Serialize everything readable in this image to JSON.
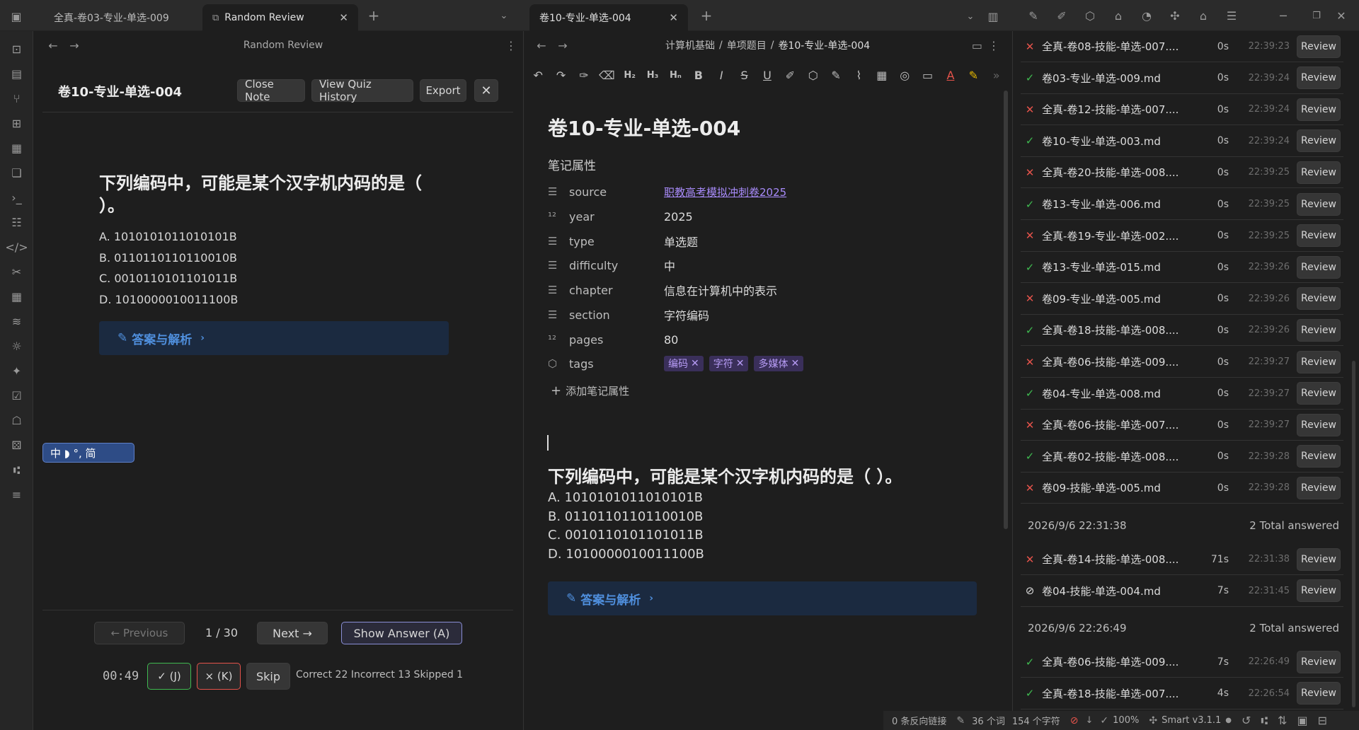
{
  "left_tabs": [
    {
      "label": "全真-卷03-专业-单选-009"
    },
    {
      "label": "Random Review"
    }
  ],
  "right_tabs": [
    {
      "label": "卷10-专业-单选-004"
    }
  ],
  "review": {
    "header_title": "Random Review",
    "note_title": "卷10-专业-单选-004",
    "close_note": "Close Note",
    "view_history": "View Quiz History",
    "export": "Export",
    "question": "下列编码中，可能是某个汉字机内码的是（ ）。",
    "options": [
      "A. 1010101011010101B",
      "B. 0110110110110010B",
      "C. 0010110101101011B",
      "D. 1010000010011100B"
    ],
    "answer_label": "答案与解析",
    "prev": "← Previous",
    "page": "1 / 30",
    "next": "Next →",
    "show_answer": "Show Answer (A)",
    "timer": "00:49",
    "correct_btn": "✓ (J)",
    "incorrect_btn": "× (K)",
    "skip": "Skip",
    "stats": "Correct 22 Incorrect 13 Skipped 1",
    "ime": "中 ◗ °, 简"
  },
  "editor": {
    "breadcrumb": [
      "计算机基础",
      "单项题目",
      "卷10-专业-单选-004"
    ],
    "title": "卷10-专业-单选-004",
    "props_heading": "笔记属性",
    "props": [
      {
        "icon": "list-icon",
        "key": "source",
        "value": "职教高考模拟冲刺卷2025"
      },
      {
        "icon": "number-icon",
        "key": "year",
        "value": "2025"
      },
      {
        "icon": "list-icon",
        "key": "type",
        "value": "单选题"
      },
      {
        "icon": "list-icon",
        "key": "difficulty",
        "value": "中"
      },
      {
        "icon": "list-icon",
        "key": "chapter",
        "value": "信息在计算机中的表示"
      },
      {
        "icon": "list-icon",
        "key": "section",
        "value": "字符编码"
      },
      {
        "icon": "number-icon",
        "key": "pages",
        "value": "80"
      }
    ],
    "tags_key": "tags",
    "tags": [
      "编码",
      "字符",
      "多媒体"
    ],
    "add_prop": "添加笔记属性",
    "question": "下列编码中，可能是某个汉字机内码的是（ ）。",
    "options": [
      "A. 1010101011010101B",
      "B. 0110110110110010B",
      "C. 0010110101101011B",
      "D. 1010000010011100B"
    ],
    "answer_label": "答案与解析"
  },
  "history": {
    "review_label": "Review",
    "rows_a": [
      {
        "status": "wrong",
        "file": "全真-卷08-技能-单选-007....",
        "dur": "0s",
        "time": "22:39:23"
      },
      {
        "status": "right",
        "file": "卷03-专业-单选-009.md",
        "dur": "0s",
        "time": "22:39:24"
      },
      {
        "status": "wrong",
        "file": "全真-卷12-技能-单选-007....",
        "dur": "0s",
        "time": "22:39:24"
      },
      {
        "status": "right",
        "file": "卷10-专业-单选-003.md",
        "dur": "0s",
        "time": "22:39:24"
      },
      {
        "status": "wrong",
        "file": "全真-卷20-技能-单选-008....",
        "dur": "0s",
        "time": "22:39:25"
      },
      {
        "status": "right",
        "file": "卷13-专业-单选-006.md",
        "dur": "0s",
        "time": "22:39:25"
      },
      {
        "status": "wrong",
        "file": "全真-卷19-专业-单选-002....",
        "dur": "0s",
        "time": "22:39:25"
      },
      {
        "status": "right",
        "file": "卷13-专业-单选-015.md",
        "dur": "0s",
        "time": "22:39:26"
      },
      {
        "status": "wrong",
        "file": "卷09-专业-单选-005.md",
        "dur": "0s",
        "time": "22:39:26"
      },
      {
        "status": "right",
        "file": "全真-卷18-技能-单选-008....",
        "dur": "0s",
        "time": "22:39:26"
      },
      {
        "status": "wrong",
        "file": "全真-卷06-技能-单选-009....",
        "dur": "0s",
        "time": "22:39:27"
      },
      {
        "status": "right",
        "file": "卷04-专业-单选-008.md",
        "dur": "0s",
        "time": "22:39:27"
      },
      {
        "status": "wrong",
        "file": "全真-卷06-技能-单选-007....",
        "dur": "0s",
        "time": "22:39:27"
      },
      {
        "status": "right",
        "file": "全真-卷02-技能-单选-008....",
        "dur": "0s",
        "time": "22:39:28"
      },
      {
        "status": "wrong",
        "file": "卷09-技能-单选-005.md",
        "dur": "0s",
        "time": "22:39:28"
      }
    ],
    "group_b": {
      "date": "2026/9/6 22:31:38",
      "count": "2 Total answered"
    },
    "rows_b": [
      {
        "status": "wrong",
        "file": "全真-卷14-技能-单选-008....",
        "dur": "71s",
        "time": "22:31:38"
      },
      {
        "status": "skip",
        "file": "卷04-技能-单选-004.md",
        "dur": "7s",
        "time": "22:31:45"
      }
    ],
    "group_c": {
      "date": "2026/9/6 22:26:49",
      "count": "2 Total answered"
    },
    "rows_c": [
      {
        "status": "right",
        "file": "全真-卷06-技能-单选-009....",
        "dur": "7s",
        "time": "22:26:49"
      },
      {
        "status": "right",
        "file": "全真-卷18-技能-单选-007....",
        "dur": "4s",
        "time": "22:26:54"
      }
    ]
  },
  "status_bar": {
    "backlinks": "0 条反向链接",
    "words": "36 个词",
    "chars": "154 个字符",
    "zoom": "100%",
    "plugin": "Smart v3.1.1"
  },
  "colors": {
    "right": "#3fb950",
    "wrong": "#e5534b",
    "accent": "#4f8fdd"
  }
}
